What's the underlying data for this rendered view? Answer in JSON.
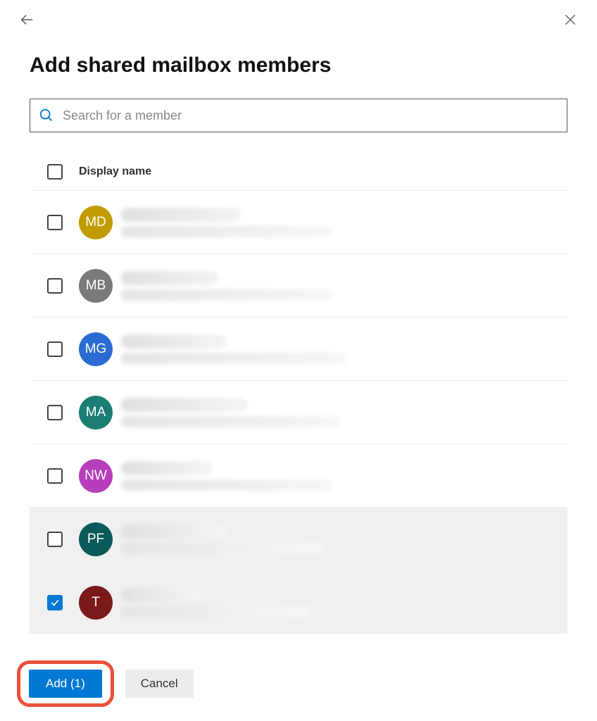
{
  "header": {
    "title": "Add shared mailbox members"
  },
  "search": {
    "placeholder": "Search for a member"
  },
  "table": {
    "column_header": "Display name"
  },
  "members": [
    {
      "initials": "MD",
      "avatar_color": "#c19c00",
      "checked": false,
      "hovered": false,
      "blur_w1": 170,
      "blur_w2": 300
    },
    {
      "initials": "MB",
      "avatar_color": "#7a7a7a",
      "checked": false,
      "hovered": false,
      "blur_w1": 140,
      "blur_w2": 300
    },
    {
      "initials": "MG",
      "avatar_color": "#2a6cd3",
      "checked": false,
      "hovered": false,
      "blur_w1": 150,
      "blur_w2": 320
    },
    {
      "initials": "MA",
      "avatar_color": "#1b7d74",
      "checked": false,
      "hovered": false,
      "blur_w1": 180,
      "blur_w2": 310
    },
    {
      "initials": "NW",
      "avatar_color": "#b83dba",
      "checked": false,
      "hovered": false,
      "blur_w1": 130,
      "blur_w2": 300
    },
    {
      "initials": "PF",
      "avatar_color": "#0b5a5a",
      "checked": false,
      "hovered": true,
      "blur_w1": 150,
      "blur_w2": 290
    },
    {
      "initials": "T",
      "avatar_color": "#7a1a1a",
      "checked": true,
      "hovered": false,
      "blur_w1": 110,
      "blur_w2": 270
    }
  ],
  "footer": {
    "add_label": "Add (1)",
    "cancel_label": "Cancel"
  }
}
